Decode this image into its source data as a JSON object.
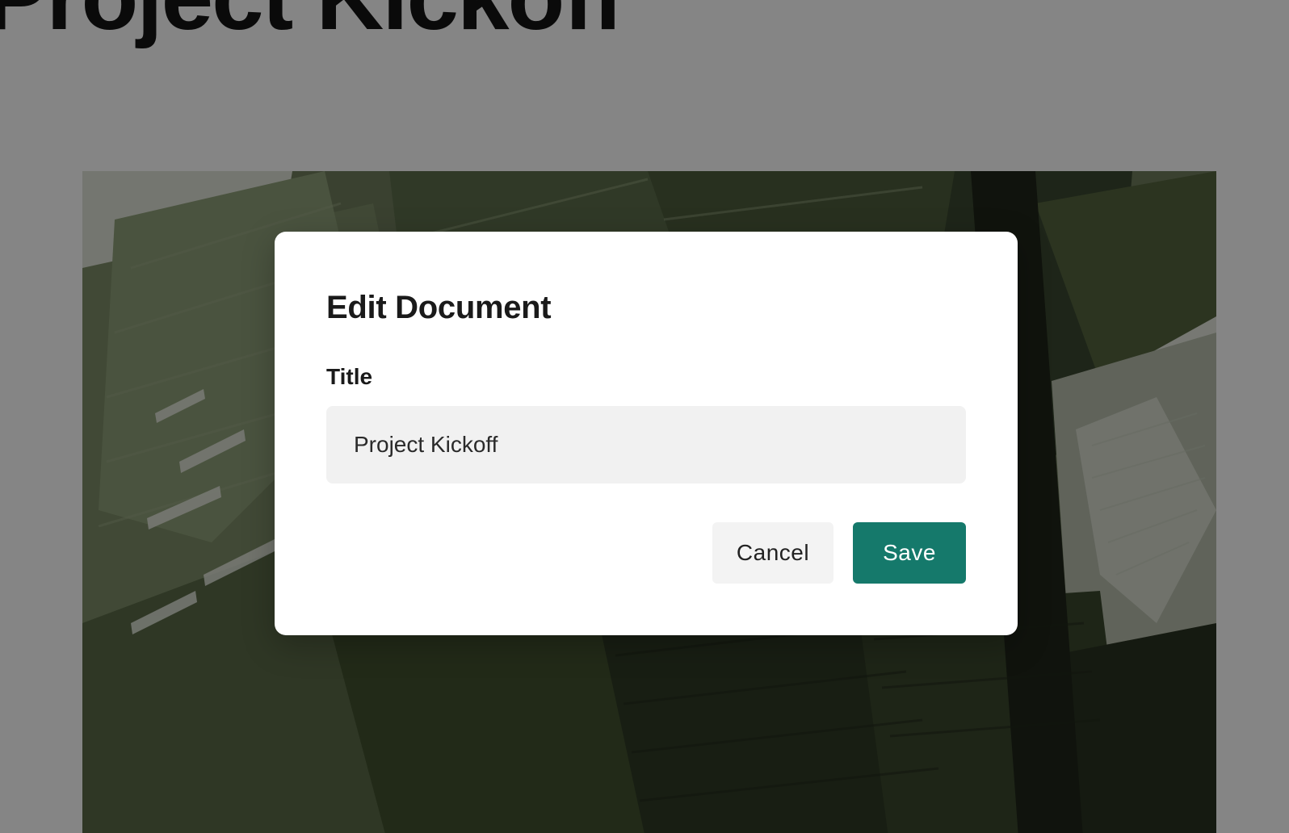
{
  "document": {
    "title": "Project Kickoff",
    "cover_image": "banana-leaves-photo"
  },
  "dialog": {
    "heading": "Edit Document",
    "title_label": "Title",
    "title_value": "Project Kickoff",
    "cancel_label": "Cancel",
    "save_label": "Save"
  },
  "colors": {
    "accent": "#15796b",
    "input_bg": "#f1f1f1",
    "overlay": "rgba(0,0,0,0.48)"
  }
}
